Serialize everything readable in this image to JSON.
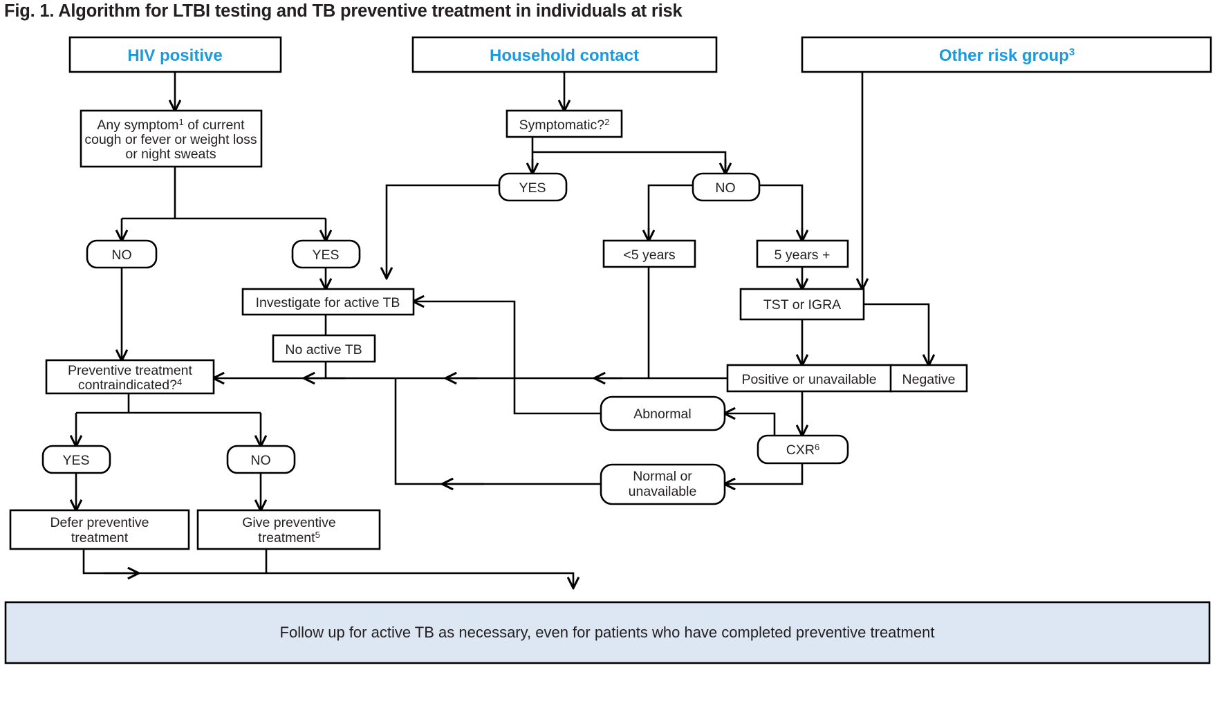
{
  "figure": {
    "title": "Fig. 1. Algorithm for LTBI testing and TB preventive treatment in individuals at risk",
    "accent_color": "#1b9ae0",
    "banner_color": "#dde7f3",
    "line_color": "#000000"
  },
  "headers": {
    "hiv_positive": "HIV positive",
    "household_contact": "Household contact",
    "other_risk_group": "Other risk group",
    "other_risk_group_superscript": "3"
  },
  "nodes": {
    "any_symptom_bold": "Any symptom",
    "any_symptom_superscript": "1",
    "any_symptom_line1_rest": " of current",
    "any_symptom_line2": "cough or fever or weight loss",
    "any_symptom_line3": "or night sweats",
    "hiv_no": "NO",
    "hiv_yes": "YES",
    "symptomatic": "Symptomatic?",
    "symptomatic_superscript": "2",
    "hh_yes": "YES",
    "hh_no": "NO",
    "under5": "<5 years",
    "over5": "5 years +",
    "investigate": "Investigate for active TB",
    "no_active_tb": "No active TB",
    "tst_or_igra": "TST or IGRA",
    "positive_bold": "Positive",
    "positive_rest": " or unavailable",
    "negative": "Negative",
    "cxr": "CXR",
    "cxr_superscript": "6",
    "abnormal": "Abnormal",
    "normal_bold": "Normal",
    "normal_rest": " or",
    "normal_line2": "unavailable",
    "contraindicated_line1": "Preventive treatment",
    "contraindicated_line2": "contraindicated?",
    "contraindicated_superscript": "4",
    "contra_yes": "YES",
    "contra_no": "NO",
    "defer_line1": "Defer preventive",
    "defer_line2": "treatment",
    "give_line1": "Give preventive",
    "give_line2": "treatment",
    "give_superscript": "5"
  },
  "footer": {
    "banner_text": "Follow up for active TB as necessary, even for patients who have completed preventive treatment"
  }
}
